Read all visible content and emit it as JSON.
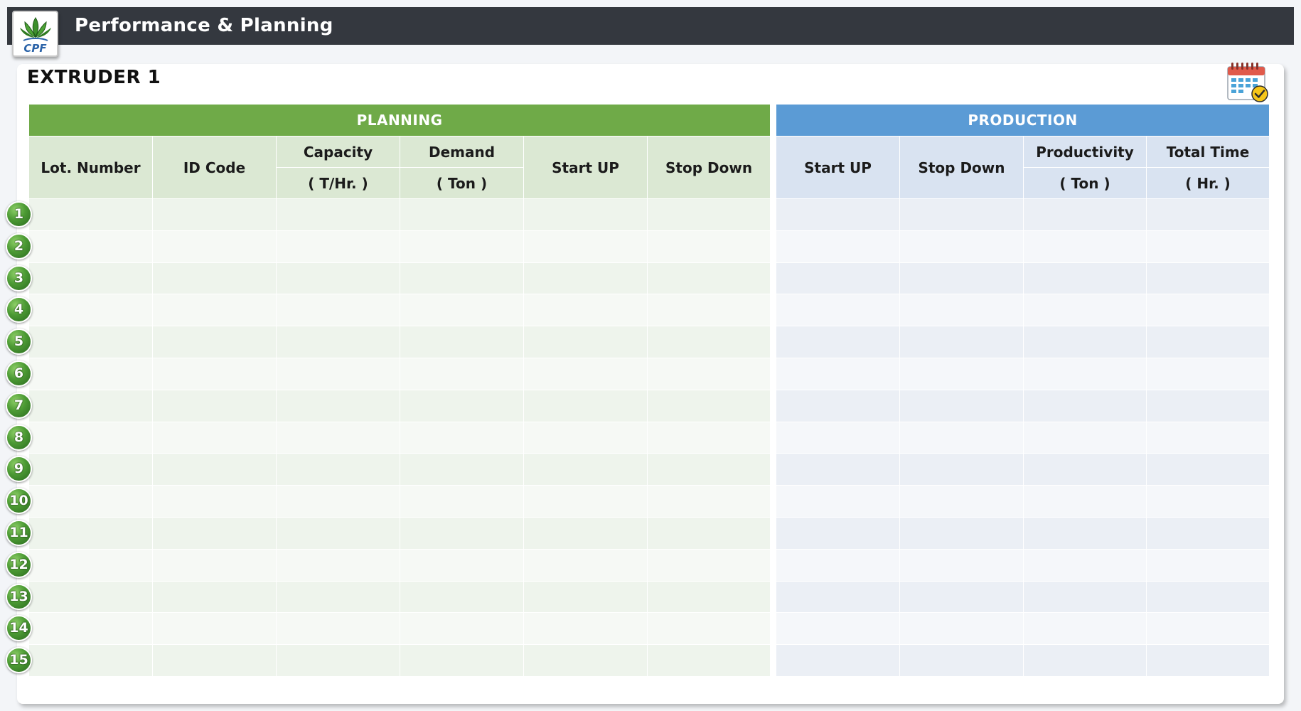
{
  "app": {
    "title": "Performance & Planning",
    "logo_text": "CPF"
  },
  "machine": {
    "title": "EXTRUDER  1"
  },
  "planning": {
    "header": "PLANNING",
    "columns": {
      "lot_number": "Lot. Number",
      "id_code": "ID Code",
      "capacity": "Capacity",
      "capacity_unit": "( T/Hr. )",
      "demand": "Demand",
      "demand_unit": "( Ton )",
      "start_up": "Start UP",
      "stop_down": "Stop Down"
    }
  },
  "production": {
    "header": "PRODUCTION",
    "columns": {
      "start_up": "Start UP",
      "stop_down": "Stop Down",
      "productivity": "Productivity",
      "productivity_unit": "( Ton )",
      "total_time": "Total Time",
      "total_time_unit": "( Hr. )"
    }
  },
  "rows": [
    "1",
    "2",
    "3",
    "4",
    "5",
    "6",
    "7",
    "8",
    "9",
    "10",
    "11",
    "12",
    "13",
    "14",
    "15"
  ],
  "colors": {
    "topbar": "#34383f",
    "planning_accent": "#6faa48",
    "production_accent": "#5b9bd5",
    "row_badge": "#4c9a34"
  },
  "icons": {
    "logo": "cpf-logo-icon",
    "calendar": "calendar-check-icon"
  }
}
